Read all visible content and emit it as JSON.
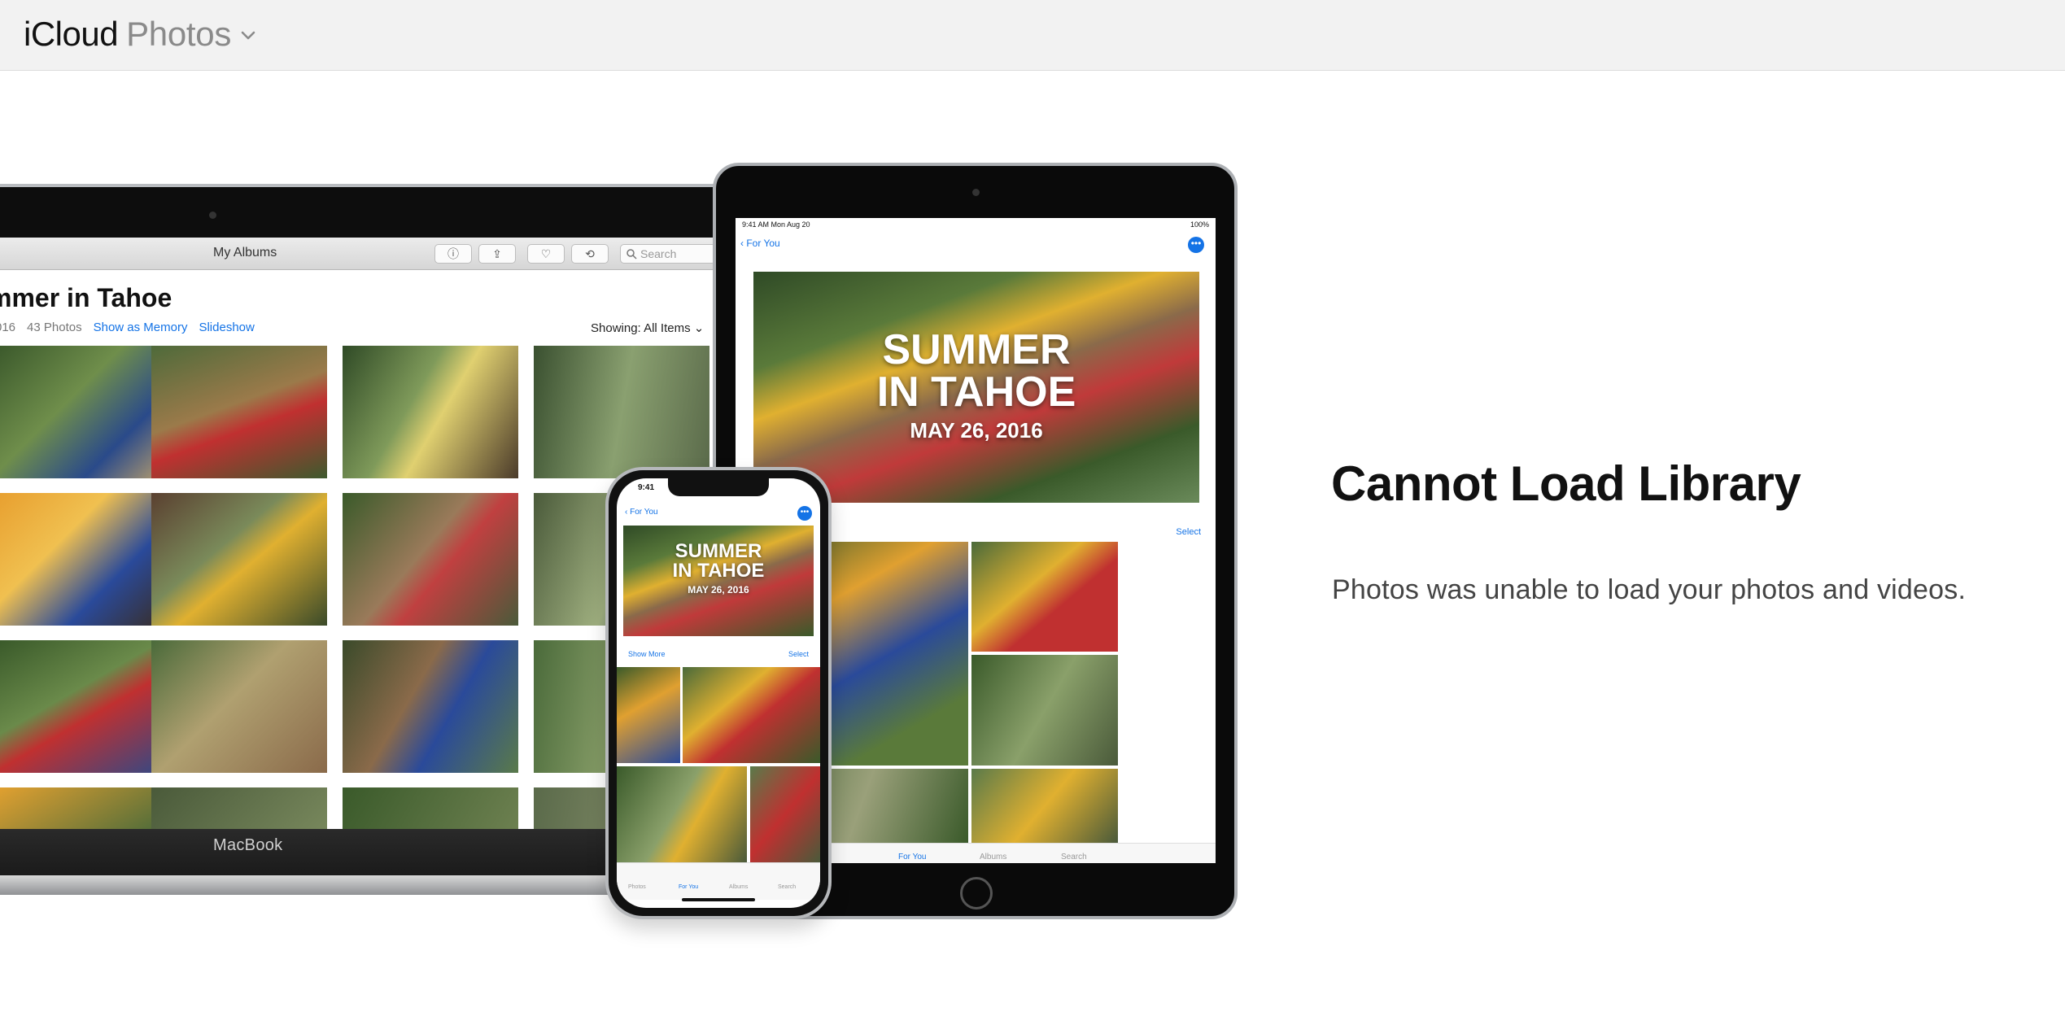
{
  "header": {
    "brand": "iCloud",
    "app_name": "Photos",
    "app_menu_icon": "chevron-down-icon"
  },
  "illustration": {
    "macbook": {
      "window_title": "My Albums",
      "search_placeholder": "Search",
      "album_title": "mmer in Tahoe",
      "album_date_fragment": "016",
      "photo_count": "43 Photos",
      "show_as_memory": "Show as Memory",
      "slideshow": "Slideshow",
      "showing_label": "Showing:",
      "showing_value": "All Items",
      "device_label": "MacBook",
      "toolbar_icons": [
        "info-icon",
        "share-icon",
        "heart-icon",
        "rotate-icon"
      ]
    },
    "ipad": {
      "status_time": "9:41 AM   Mon Aug 20",
      "status_battery": "100%",
      "back_label": "For You",
      "memory_title_line1": "SUMMER",
      "memory_title_line2": "IN TAHOE",
      "memory_date": "MAY 26, 2016",
      "select_label": "Select",
      "tabs": [
        "For You",
        "Albums",
        "Search"
      ]
    },
    "iphone": {
      "status_time": "9:41",
      "back_label": "For You",
      "memory_title_line1": "SUMMER",
      "memory_title_line2": "IN TAHOE",
      "memory_date": "MAY 26, 2016",
      "show_more": "Show More",
      "select_label": "Select",
      "tabs": [
        "Photos",
        "For You",
        "Albums",
        "Search"
      ]
    }
  },
  "error": {
    "title": "Cannot Load Library",
    "message": "Photos was unable to load your photos and videos."
  },
  "colors": {
    "header_bg": "#f2f2f2",
    "accent_blue": "#1473e6",
    "title_text": "#111111",
    "body_text": "#444444",
    "brand_secondary": "#8a8a8a"
  }
}
